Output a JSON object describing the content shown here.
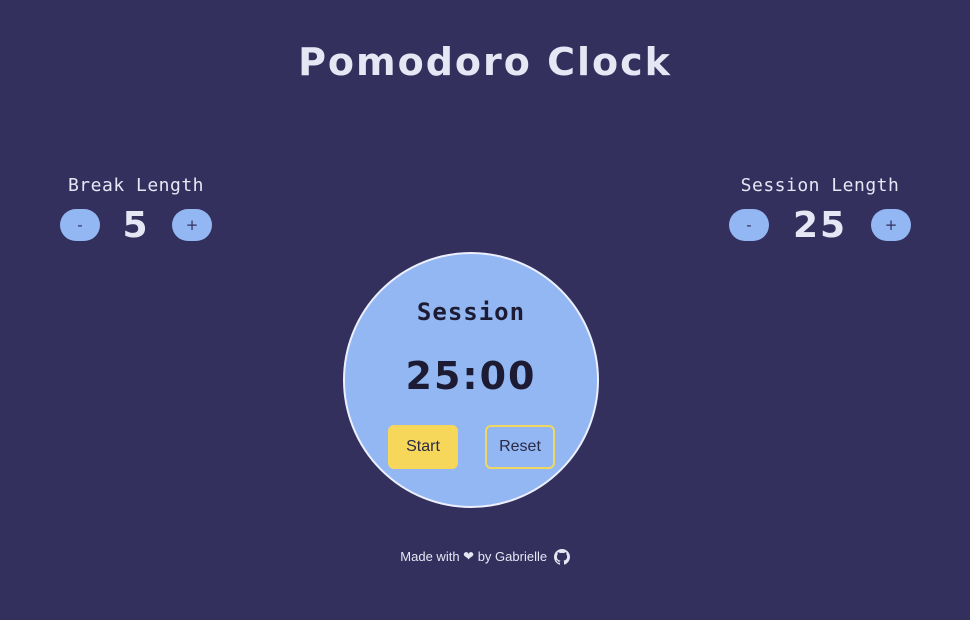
{
  "app": {
    "title": "Pomodoro Clock"
  },
  "break_control": {
    "label": "Break Length",
    "decrement_label": "-",
    "increment_label": "+",
    "value": "5"
  },
  "session_control": {
    "label": "Session Length",
    "decrement_label": "-",
    "increment_label": "+",
    "value": "25"
  },
  "timer": {
    "label": "Session",
    "time": "25:00",
    "start_label": "Start",
    "reset_label": "Reset"
  },
  "footer": {
    "made_with": "Made with",
    "heart": "❤",
    "by": "by Gabrielle",
    "icon": "github-icon"
  },
  "colors": {
    "background": "#33305d",
    "accent": "#93b7f3",
    "start": "#f6d75a"
  }
}
